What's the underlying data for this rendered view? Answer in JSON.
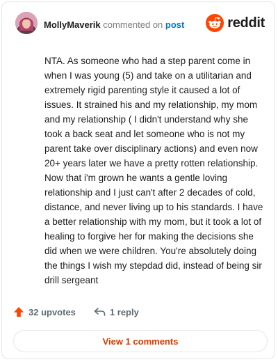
{
  "header": {
    "username": "MollyMaverik",
    "action_text": "commented on",
    "post_link": "post",
    "brand_name": "reddit"
  },
  "comment": {
    "body": "NTA. As someone who had a step parent come in when I was young (5) and take on a utilitarian and extremely rigid parenting style it caused a lot of issues. It strained his and my relationship, my mom and my relationship ( I didn't understand why she took a back seat and let someone who is not my parent take over disciplinary actions) and even now 20+ years later we have a pretty rotten relationship. Now that i'm grown he wants a gentle loving relationship and I just can't after 2 decades of cold, distance, and never living up to his standards. I have a better relationship with my mom, but it took a lot of healing to forgive her for making the decisions she did when we were children. You're absolutely doing the things I wish my stepdad did, instead of being sir drill sergeant"
  },
  "stats": {
    "upvotes_label": "32 upvotes",
    "replies_label": "1 reply"
  },
  "footer": {
    "view_comments_label": "View 1 comments"
  },
  "colors": {
    "brand_orange": "#ff4500",
    "link_blue": "#0079d3",
    "view_button_text": "#d93a00",
    "meta_gray": "#5c6b73"
  },
  "icons": {
    "avatar": "user-avatar-photo",
    "brand": "reddit-snoo-icon",
    "upvote": "upvote-arrow-icon",
    "reply": "reply-arrow-icon"
  }
}
